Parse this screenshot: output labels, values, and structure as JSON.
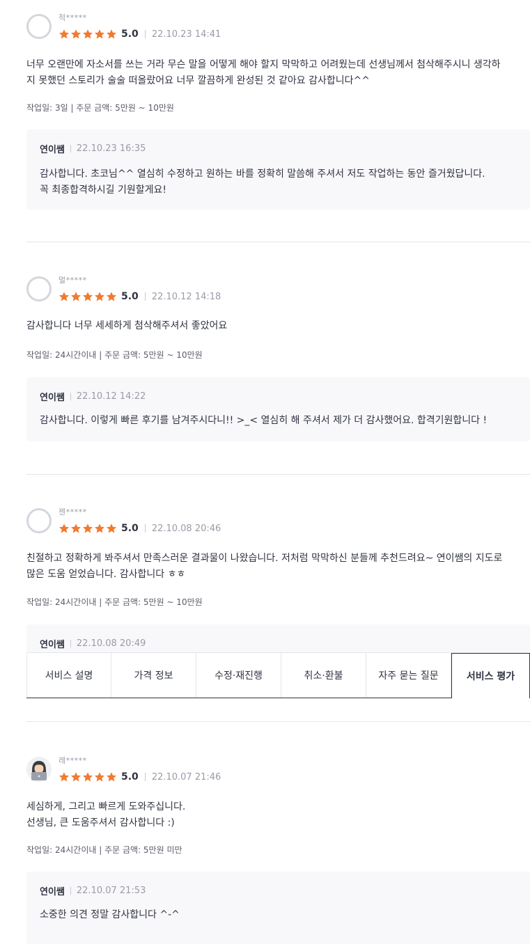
{
  "colors": {
    "star": "#f17a2f",
    "text": "#303441",
    "muted": "#9a9ba7"
  },
  "reviews": [
    {
      "nickname": "적*****",
      "avatar": "default-avatar-icon",
      "score": "5.0",
      "date": "22.10.23 14:41",
      "stars": 5,
      "text": "너무 오랜만에 자소서를 쓰는 거라 무슨 말을 어떻게 해야 할지 막막하고 어려웠는데 선생님께서 첨삭해주시니 생각하\n지 못했던 스토리가 술술 떠올랐어요 너무 깔끔하게 완성된 것 같아요 감사합니다^^",
      "meta": "작업일: 3일 | 주문 금액: 5만원 ~ 10만원",
      "reply": {
        "name": "연이쌤",
        "date": "22.10.23 16:35",
        "text": "감사합니다. 초코님^^  열심히 수정하고 원하는 바를 정확히 말씀해 주셔서 저도 작업하는 동안 즐거웠답니다.\n꼭 최종합격하시길 기원할게요!"
      }
    },
    {
      "nickname": "멀*****",
      "avatar": "default-avatar-icon",
      "score": "5.0",
      "date": "22.10.12 14:18",
      "stars": 5,
      "text": "감사합니다 너무 세세하게 첨삭해주셔서 좋았어요",
      "meta": "작업일: 24시간이내 | 주문 금액: 5만원 ~ 10만원",
      "reply": {
        "name": "연이쌤",
        "date": "22.10.12 14:22",
        "text": "감사합니다. 이렇게 빠른 후기를 남겨주시다니!! >_< 열심히 해 주셔서 제가 더 감사했어요. 합격기원합니다 !"
      }
    },
    {
      "nickname": "젠*****",
      "avatar": "default-avatar-icon",
      "score": "5.0",
      "date": "22.10.08 20:46",
      "stars": 5,
      "text": "친절하고 정확하게 봐주셔서 만족스러운 결과물이 나왔습니다. 저처럼 막막하신 분들께 추천드려요~ 연이쌤의 지도로\n많은 도움 얻었습니다. 감사합니다 ㅎㅎ",
      "meta": "작업일: 24시간이내 | 주문 금액: 5만원 ~ 10만원",
      "reply": {
        "name": "연이쌤",
        "date": "22.10.08 20:49",
        "text": ""
      }
    },
    {
      "nickname": "레*****",
      "avatar": "laptop-person-avatar-icon",
      "score": "5.0",
      "date": "22.10.07 21:46",
      "stars": 5,
      "text": "세심하게, 그리고 빠르게 도와주십니다.\n선생님, 큰 도움주셔서 감사합니다 :)",
      "meta": "작업일: 24시간이내 | 주문 금액: 5만원 미만",
      "reply": {
        "name": "연이쌤",
        "date": "22.10.07 21:53",
        "text": "소중한 의견  정말 감사합니다 ^-^"
      }
    }
  ],
  "tabs": [
    {
      "label": "서비스 설명",
      "active": false
    },
    {
      "label": "가격 정보",
      "active": false
    },
    {
      "label": "수정·재진행",
      "active": false
    },
    {
      "label": "취소·환불",
      "active": false
    },
    {
      "label": "자주 묻는 질문",
      "active": false
    },
    {
      "label": "서비스 평가",
      "active": true
    }
  ]
}
